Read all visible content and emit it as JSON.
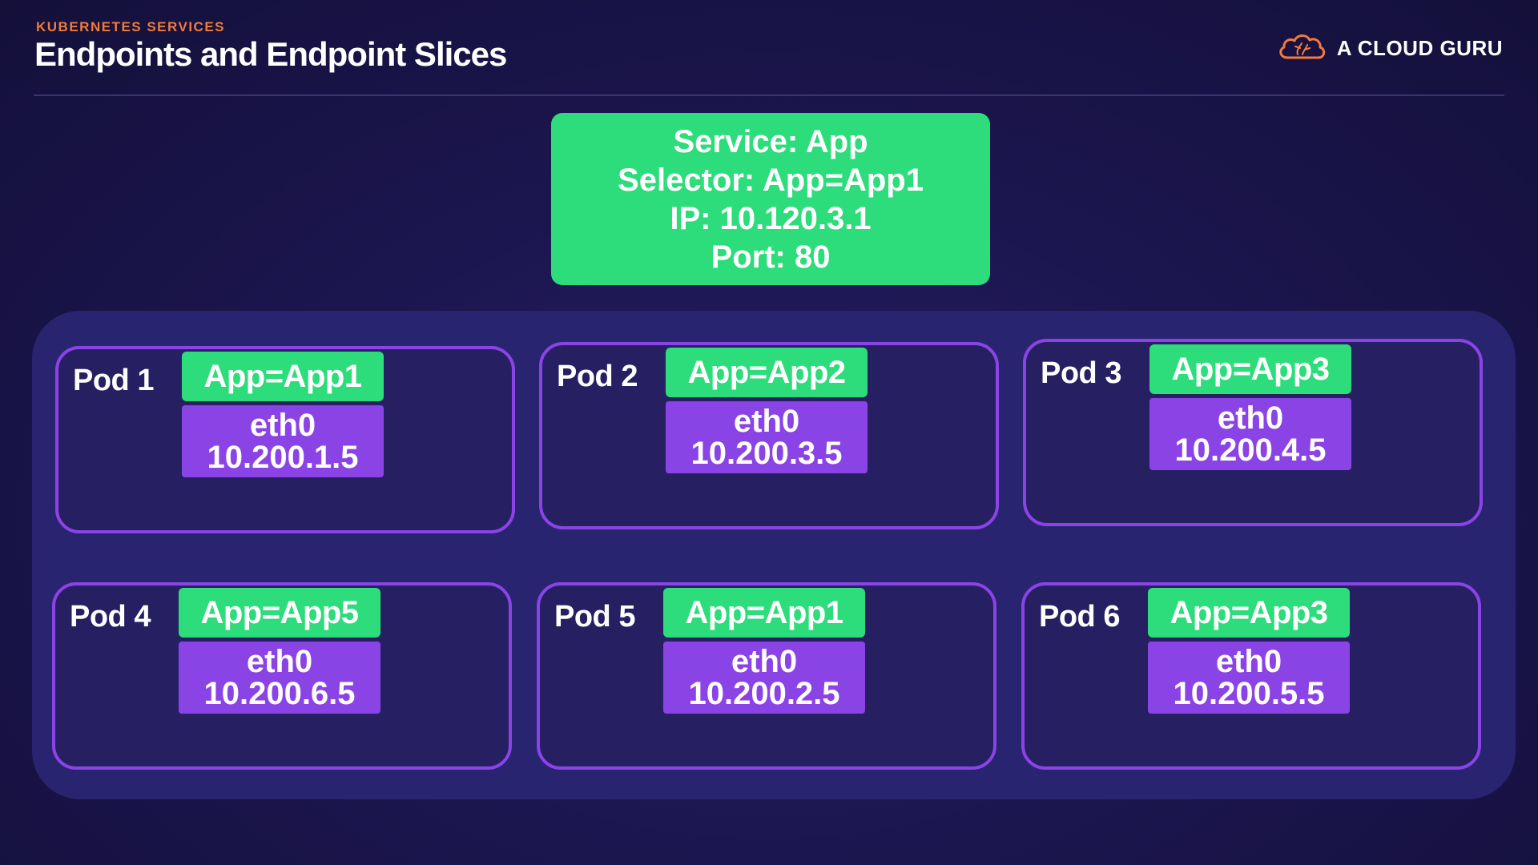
{
  "header": {
    "eyebrow": "KUBERNETES SERVICES",
    "title": "Endpoints and Endpoint Slices",
    "brand": "A CLOUD GURU"
  },
  "service": {
    "line1": "Service: App",
    "line2": "Selector: App=App1",
    "line3": "IP: 10.120.3.1",
    "line4": "Port: 80"
  },
  "pods": [
    {
      "name": "Pod 1",
      "label": "App=App1",
      "iface": "eth0",
      "ip": "10.200.1.5"
    },
    {
      "name": "Pod 2",
      "label": "App=App2",
      "iface": "eth0",
      "ip": "10.200.3.5"
    },
    {
      "name": "Pod 3",
      "label": "App=App3",
      "iface": "eth0",
      "ip": "10.200.4.5"
    },
    {
      "name": "Pod 4",
      "label": "App=App5",
      "iface": "eth0",
      "ip": "10.200.6.5"
    },
    {
      "name": "Pod 5",
      "label": "App=App1",
      "iface": "eth0",
      "ip": "10.200.2.5"
    },
    {
      "name": "Pod 6",
      "label": "App=App3",
      "iface": "eth0",
      "ip": "10.200.5.5"
    }
  ],
  "colors": {
    "accent_orange": "#f07b3a",
    "service_green": "#2ddc7a",
    "pod_purple": "#8a44e6",
    "panel": "#29246f",
    "background": "#1c1650"
  },
  "icons": {
    "brand_logo": "cloud-icon"
  }
}
